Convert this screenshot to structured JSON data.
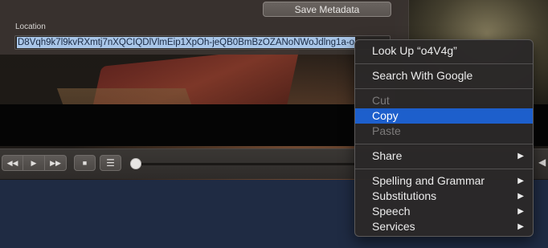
{
  "metadata_panel": {
    "save_button_label": "Save Metadata",
    "location_label": "Location",
    "location_value": "D8Vqh9k7l9kvRXmtj7nXQCIQDlVlmEip1XpOh-jeQB0BmBzOZANoNWoJdlng1a-o"
  },
  "controls": {
    "rewind_icon": "◀◀",
    "play_icon": "▶",
    "forward_icon": "▶▶",
    "stop_icon": "■",
    "playlist_icon": "☰",
    "volume_icon": "◀"
  },
  "context_menu": {
    "items": [
      {
        "label": "Look Up “o4V4g”"
      },
      {
        "label": "Search With Google"
      },
      {
        "label": "Cut"
      },
      {
        "label": "Copy"
      },
      {
        "label": "Paste"
      },
      {
        "label": "Share",
        "arrow": "▶"
      },
      {
        "label": "Spelling and Grammar",
        "arrow": "▶"
      },
      {
        "label": "Substitutions",
        "arrow": "▶"
      },
      {
        "label": "Speech",
        "arrow": "▶"
      },
      {
        "label": "Services",
        "arrow": "▶"
      }
    ]
  }
}
